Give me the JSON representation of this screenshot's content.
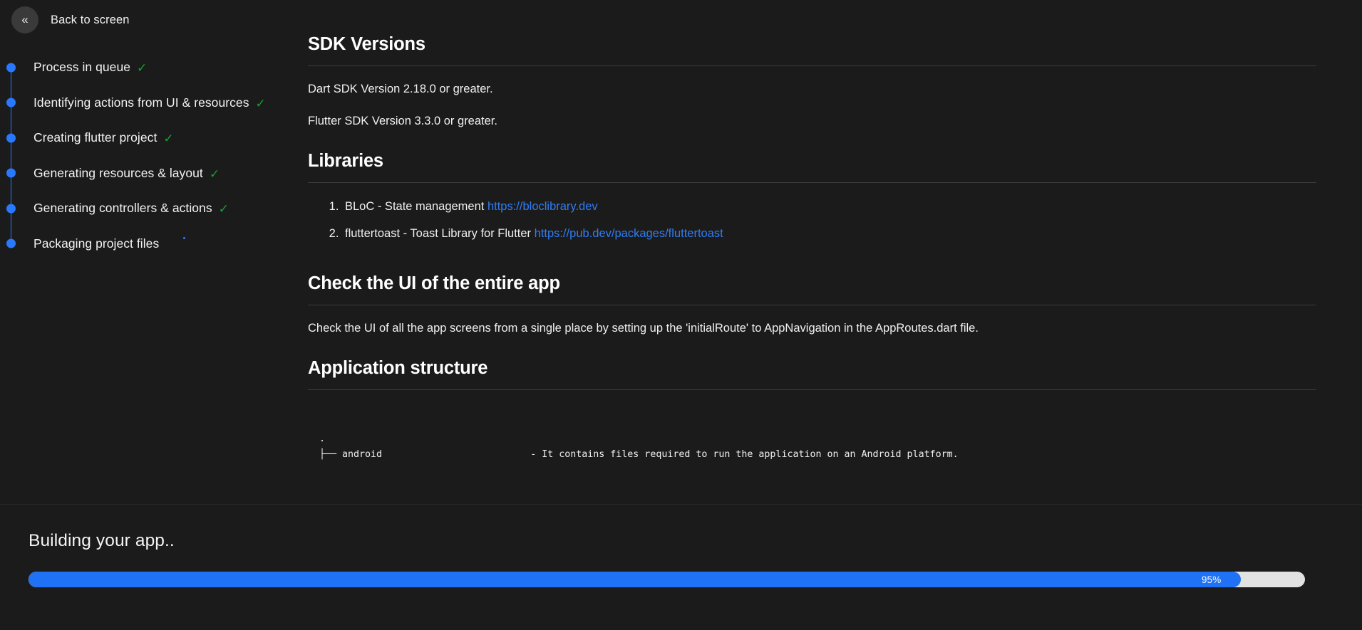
{
  "colors": {
    "background": "#1b1b1b",
    "accent_blue": "#2979ff",
    "link_blue": "#2f7df4",
    "check_green": "#12a330",
    "progress_fill": "#1f71f5",
    "progress_track": "#e2e2e2"
  },
  "topbar": {
    "back_icon": "double-chevron-left-icon",
    "back_label": "Back to screen"
  },
  "steps": [
    {
      "label": "Process in queue",
      "status": "done",
      "check": "✓"
    },
    {
      "label": "Identifying actions from UI & resources",
      "status": "done",
      "check": "✓"
    },
    {
      "label": "Creating flutter project",
      "status": "done",
      "check": "✓"
    },
    {
      "label": "Generating resources & layout",
      "status": "done",
      "check": "✓"
    },
    {
      "label": "Generating controllers & actions",
      "status": "done",
      "check": "✓"
    },
    {
      "label": "Packaging project files",
      "status": "in-progress",
      "check": ""
    }
  ],
  "doc": {
    "sdk": {
      "heading": "SDK Versions",
      "line1": "Dart SDK Version 2.18.0 or greater.",
      "line2": "Flutter SDK Version 3.3.0 or greater."
    },
    "libraries": {
      "heading": "Libraries",
      "items": [
        {
          "text": "BLoC - State management ",
          "link": "https://bloclibrary.dev"
        },
        {
          "text": "fluttertoast - Toast Library for Flutter ",
          "link": "https://pub.dev/packages/fluttertoast"
        }
      ]
    },
    "check_ui": {
      "heading": "Check the UI of the entire app",
      "body": "Check the UI of all the app screens from a single place by setting up the 'initialRoute' to AppNavigation in the AppRoutes.dart file."
    },
    "structure": {
      "heading": "Application structure",
      "tree": ".\n├── android                          - It contains files required to run the application on an Android platform."
    }
  },
  "build": {
    "title": "Building your app..",
    "progress_label": "95%",
    "progress_percent": 95
  }
}
